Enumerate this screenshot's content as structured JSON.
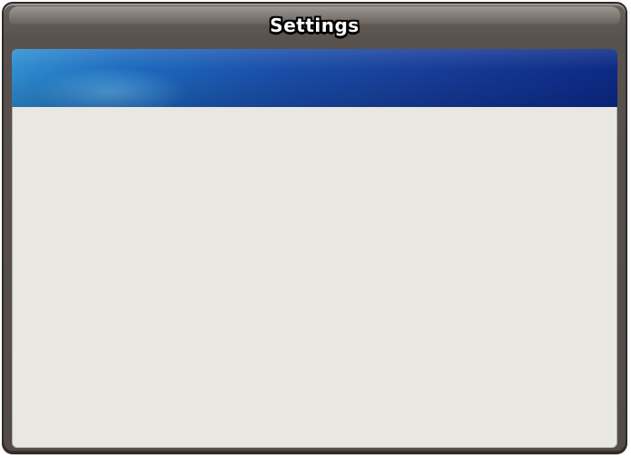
{
  "window": {
    "title": "Settings"
  },
  "colors": {
    "frame": "#58514c",
    "panel": "#e8e7e1",
    "banner_start": "#2f8ed0",
    "banner_end": "#0c2a86"
  }
}
